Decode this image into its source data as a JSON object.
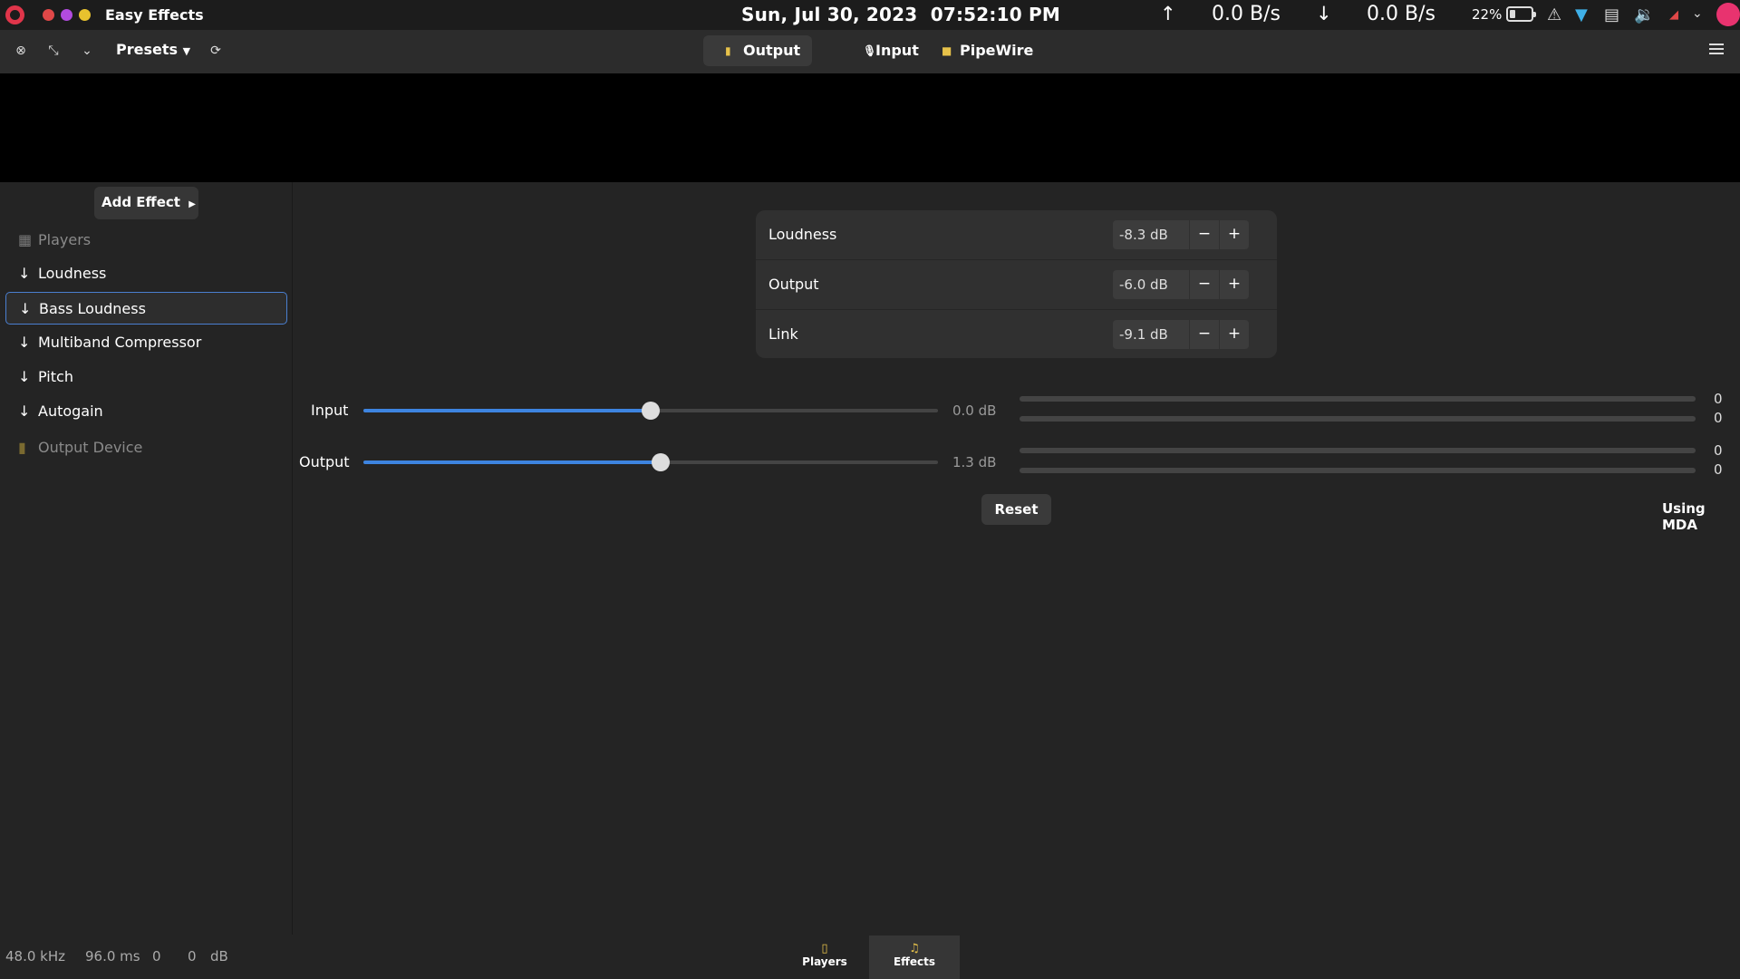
{
  "topbar": {
    "app_name": "Easy Effects",
    "datetime": "Sun, Jul 30, 2023  07:52:10 PM",
    "upload_arrow": "↑",
    "upload_rate": "0.0 B/s",
    "download_arrow": "↓",
    "download_rate": "0.0 B/s",
    "battery_percent": "22%",
    "window_dots": [
      "#e04848",
      "#b24be0",
      "#e8c22e"
    ]
  },
  "headerbar": {
    "presets_label": "Presets",
    "tabs": [
      {
        "label": "Output",
        "icon": "speaker-icon",
        "active": true
      },
      {
        "label": "Input",
        "icon": "microphone-icon",
        "active": false
      },
      {
        "label": "PipeWire",
        "icon": "pipewire-icon",
        "active": false
      }
    ]
  },
  "sidebar": {
    "add_effect_label": "Add Effect",
    "items": [
      {
        "label": "Players",
        "kind": "source"
      },
      {
        "label": "Loudness",
        "kind": "effect"
      },
      {
        "label": "Bass Loudness",
        "kind": "effect",
        "selected": true
      },
      {
        "label": "Multiband Compressor",
        "kind": "effect"
      },
      {
        "label": "Pitch",
        "kind": "effect"
      },
      {
        "label": "Autogain",
        "kind": "effect"
      },
      {
        "label": "Output Device",
        "kind": "sink"
      }
    ]
  },
  "plugin": {
    "params": [
      {
        "label": "Loudness",
        "value": "-8.3 dB"
      },
      {
        "label": "Output",
        "value": "-6.0 dB"
      },
      {
        "label": "Link",
        "value": "-9.1 dB"
      }
    ],
    "minus": "−",
    "plus": "+",
    "levels": [
      {
        "label": "Input",
        "value": "0.0 dB",
        "slider_fraction": 0.5,
        "meters": [
          "0",
          "0"
        ]
      },
      {
        "label": "Output",
        "value": "1.3 dB",
        "slider_fraction": 0.517,
        "meters": [
          "0",
          "0"
        ]
      }
    ],
    "reset_label": "Reset",
    "backend_label": "Using MDA"
  },
  "statusbar": {
    "sample_rate": "48.0 kHz",
    "latency": "96.0 ms",
    "left_level": "0",
    "right_level": "0",
    "level_unit": "dB"
  },
  "bottom_tabs": [
    {
      "label": "Players",
      "icon": "players-icon",
      "active": false
    },
    {
      "label": "Effects",
      "icon": "music-note-icon",
      "active": true
    }
  ],
  "colors": {
    "accent": "#3d84e0",
    "selection_border": "#4a7fd0",
    "avatar": "#e8336f"
  }
}
